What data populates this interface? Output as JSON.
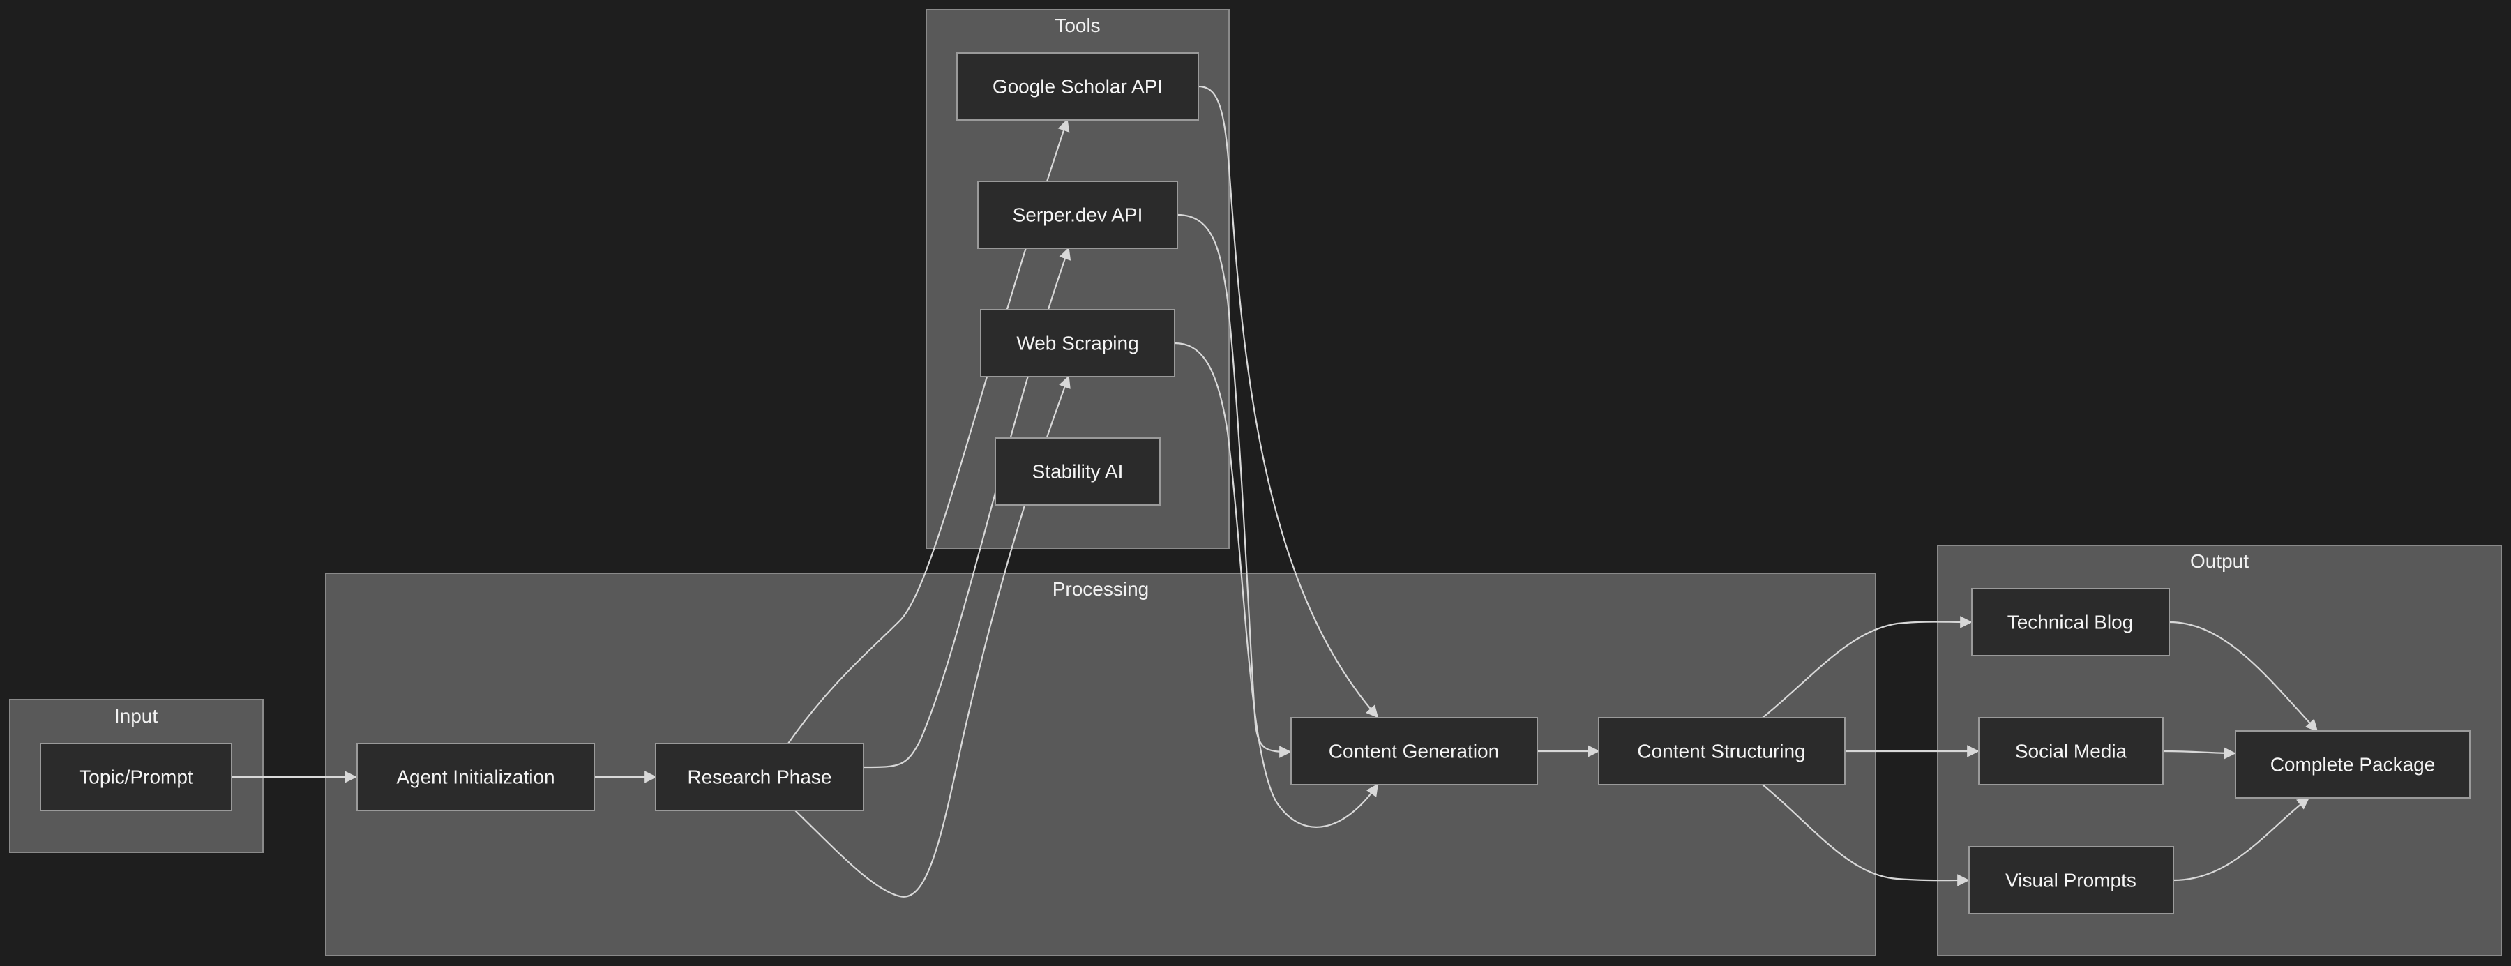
{
  "clusters": {
    "input": {
      "label": "Input"
    },
    "processing": {
      "label": "Processing"
    },
    "tools": {
      "label": "Tools"
    },
    "output": {
      "label": "Output"
    }
  },
  "nodes": {
    "topic_prompt": "Topic/Prompt",
    "agent_init": "Agent Initialization",
    "research_phase": "Research Phase",
    "content_generation": "Content Generation",
    "content_structuring": "Content Structuring",
    "google_scholar": "Google Scholar API",
    "serper_dev": "Serper.dev API",
    "web_scraping": "Web Scraping",
    "stability_ai": "Stability AI",
    "technical_blog": "Technical Blog",
    "social_media": "Social Media",
    "visual_prompts": "Visual Prompts",
    "complete_package": "Complete Package"
  },
  "edges": [
    {
      "from": "Topic/Prompt",
      "to": "Agent Initialization"
    },
    {
      "from": "Agent Initialization",
      "to": "Research Phase"
    },
    {
      "from": "Research Phase",
      "to": "Google Scholar API"
    },
    {
      "from": "Research Phase",
      "to": "Serper.dev API"
    },
    {
      "from": "Research Phase",
      "to": "Web Scraping"
    },
    {
      "from": "Google Scholar API",
      "to": "Content Generation"
    },
    {
      "from": "Serper.dev API",
      "to": "Content Generation"
    },
    {
      "from": "Web Scraping",
      "to": "Content Generation"
    },
    {
      "from": "Content Generation",
      "to": "Content Structuring"
    },
    {
      "from": "Content Structuring",
      "to": "Technical Blog"
    },
    {
      "from": "Content Structuring",
      "to": "Social Media"
    },
    {
      "from": "Content Structuring",
      "to": "Visual Prompts"
    },
    {
      "from": "Technical Blog",
      "to": "Complete Package"
    },
    {
      "from": "Social Media",
      "to": "Complete Package"
    },
    {
      "from": "Visual Prompts",
      "to": "Complete Package"
    }
  ],
  "colors": {
    "background": "#1e1e1e",
    "cluster_fill": "#595959",
    "node_fill": "#2b2b2b",
    "edge_stroke": "#d8d8d8",
    "text": "#f5f5f5"
  }
}
